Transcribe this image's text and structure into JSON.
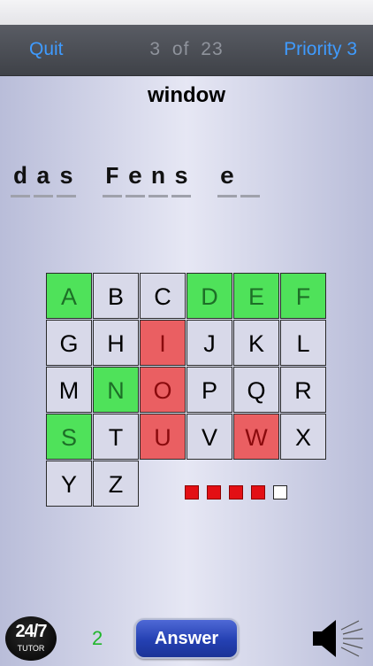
{
  "nav": {
    "quit_label": "Quit",
    "current": "3",
    "of_label": "of",
    "total": "23",
    "priority_label": "Priority 3"
  },
  "word": "window",
  "answer_slots": [
    "d",
    "a",
    "s",
    "",
    "F",
    "e",
    "n",
    "s",
    "",
    "e",
    ""
  ],
  "letters": [
    {
      "letter": "A",
      "state": "correct"
    },
    {
      "letter": "B",
      "state": "unused"
    },
    {
      "letter": "C",
      "state": "unused"
    },
    {
      "letter": "D",
      "state": "correct"
    },
    {
      "letter": "E",
      "state": "correct"
    },
    {
      "letter": "F",
      "state": "correct"
    },
    {
      "letter": "G",
      "state": "unused"
    },
    {
      "letter": "H",
      "state": "unused"
    },
    {
      "letter": "I",
      "state": "wrong"
    },
    {
      "letter": "J",
      "state": "unused"
    },
    {
      "letter": "K",
      "state": "unused"
    },
    {
      "letter": "L",
      "state": "unused"
    },
    {
      "letter": "M",
      "state": "unused"
    },
    {
      "letter": "N",
      "state": "correct"
    },
    {
      "letter": "O",
      "state": "wrong"
    },
    {
      "letter": "P",
      "state": "unused"
    },
    {
      "letter": "Q",
      "state": "unused"
    },
    {
      "letter": "R",
      "state": "unused"
    },
    {
      "letter": "S",
      "state": "correct"
    },
    {
      "letter": "T",
      "state": "unused"
    },
    {
      "letter": "U",
      "state": "wrong"
    },
    {
      "letter": "V",
      "state": "unused"
    },
    {
      "letter": "W",
      "state": "wrong"
    },
    {
      "letter": "X",
      "state": "unused"
    },
    {
      "letter": "Y",
      "state": "unused"
    },
    {
      "letter": "Z",
      "state": "unused"
    }
  ],
  "lives": {
    "used": 4,
    "total": 5
  },
  "footer": {
    "logo_top": "24/7",
    "logo_bottom": "TUTOR",
    "score": "2",
    "answer_label": "Answer",
    "speaker_icon": "speaker-icon"
  },
  "colors": {
    "correct": "#4fe25a",
    "wrong": "#ea5f62",
    "nav_link": "#3f9bff",
    "score": "#1fb62a",
    "life_used": "#e30f14"
  }
}
